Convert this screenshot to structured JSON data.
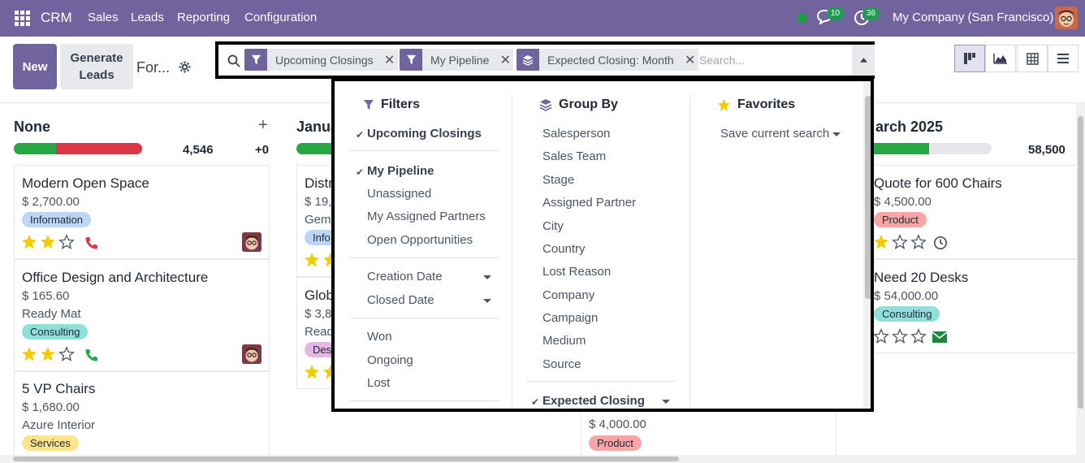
{
  "nav": {
    "brand": "CRM",
    "menu": [
      "Sales",
      "Leads",
      "Reporting",
      "Configuration"
    ],
    "messages_count": "10",
    "activities_count": "36",
    "company": "My Company (San Francisco)"
  },
  "control": {
    "new_label": "New",
    "generate_label": "Generate Leads",
    "breadcrumb": "For...",
    "facets": [
      "Upcoming Closings",
      "My Pipeline",
      "Expected Closing: Month"
    ],
    "search_placeholder": "Search..."
  },
  "columns": [
    {
      "title": "None",
      "total": "4,546",
      "extra": "+0"
    },
    {
      "title": "Janua"
    },
    {
      "title": "arch 2025",
      "total": "58,500"
    }
  ],
  "cards": {
    "col1": [
      {
        "title": "Modern Open Space",
        "amount": "$ 2,700.00",
        "tag": "Information"
      },
      {
        "title": "Office Design and Architecture",
        "amount": "$ 165.60",
        "company": "Ready Mat",
        "tag": "Consulting"
      },
      {
        "title": "5 VP Chairs",
        "amount": "$ 1,680.00",
        "company": "Azure Interior",
        "tag": "Services"
      }
    ],
    "col2": [
      {
        "title": "Distr",
        "amount": "$ 19,8",
        "company": "Gemi",
        "tag": "Info"
      },
      {
        "title": "Glob",
        "amount": "$ 3,80",
        "company": "Ready",
        "tag": "Desi"
      }
    ],
    "col3": [
      {
        "amount": "$ 4,000.00",
        "tag": "Product"
      }
    ],
    "col4": [
      {
        "title": "Quote for 600 Chairs",
        "amount": "$ 4,500.00",
        "tag": "Product"
      },
      {
        "title": "Need 20 Desks",
        "amount": "$ 54,000.00",
        "tag": "Consulting"
      }
    ]
  },
  "dropdown": {
    "filters": {
      "title": "Filters",
      "group1": [
        "Upcoming Closings"
      ],
      "group2": [
        "My Pipeline",
        "Unassigned",
        "My Assigned Partners",
        "Open Opportunities"
      ],
      "group3": [
        "Creation Date",
        "Closed Date"
      ],
      "group4": [
        "Won",
        "Ongoing",
        "Lost"
      ]
    },
    "groupby": {
      "title": "Group By",
      "items": [
        "Salesperson",
        "Sales Team",
        "Stage",
        "Assigned Partner",
        "City",
        "Country",
        "Lost Reason",
        "Company",
        "Campaign",
        "Medium",
        "Source"
      ],
      "expected": "Expected Closing"
    },
    "favorites": {
      "title": "Favorites",
      "save": "Save current search"
    }
  },
  "colors": {
    "brand": "#71639e",
    "green": "#28a745",
    "red": "#dc3545",
    "star": "#f3cc00"
  }
}
